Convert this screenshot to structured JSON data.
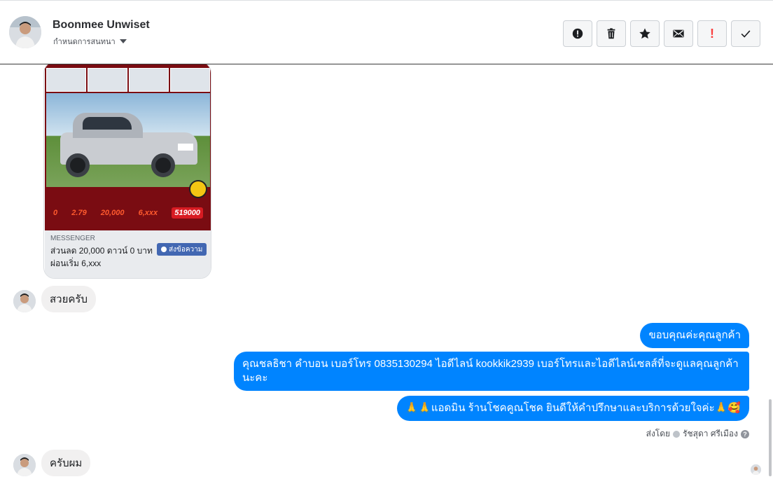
{
  "header": {
    "contact_name": "Boonmee Unwiset",
    "assign_label": "กำหนดการสนทนา"
  },
  "toolbar": {
    "buttons": [
      {
        "name": "mark-spam",
        "icon": "alert-circle-icon"
      },
      {
        "name": "delete",
        "icon": "trash-icon"
      },
      {
        "name": "star",
        "icon": "star-icon"
      },
      {
        "name": "mark-unread",
        "icon": "envelope-icon"
      },
      {
        "name": "follow-up",
        "icon": "exclamation-icon",
        "glyph": "!"
      },
      {
        "name": "mark-done",
        "icon": "checkmark-icon"
      }
    ]
  },
  "colors": {
    "outgoing_bubble": "#0084ff",
    "incoming_bubble": "#f1f0f0",
    "messenger_button": "#4267b2",
    "follow_up": "#fa3e3e"
  },
  "ad_card": {
    "prices": [
      "0",
      "2.79",
      "20,000",
      "6,xxx",
      "519000"
    ],
    "messenger_label": "MESSENGER",
    "line1": "ส่วนลด 20,000 ดาวน์ 0 บาท",
    "line2": "ผ่อนเริ่ม 6,xxx",
    "send_button": "ส่งข้อความ"
  },
  "messages": [
    {
      "direction": "in",
      "text": "สวยครับ"
    },
    {
      "direction": "out",
      "text": "ขอบคุณค่ะคุณลูกค้า"
    },
    {
      "direction": "out",
      "text": "คุณชลธิชา คำบอน เบอร์โทร 0835130294  ไอดีไลน์ kookkik2939   เบอร์โทรและไอดีไลน์เซลส์ที่จะดูแลคุณลูกค้านะคะ"
    },
    {
      "direction": "out",
      "text": "🙏🙏แอดมิน ร้านโชคคูณโชค ยินดีให้คำปรึกษาและบริการด้วยใจค่ะ🙏🥰"
    },
    {
      "direction": "in",
      "text": "ครับผม"
    }
  ],
  "sent_by": {
    "prefix": "ส่งโดย",
    "agent": "รัชสุดา ศรีเมือง",
    "help_glyph": "?"
  }
}
